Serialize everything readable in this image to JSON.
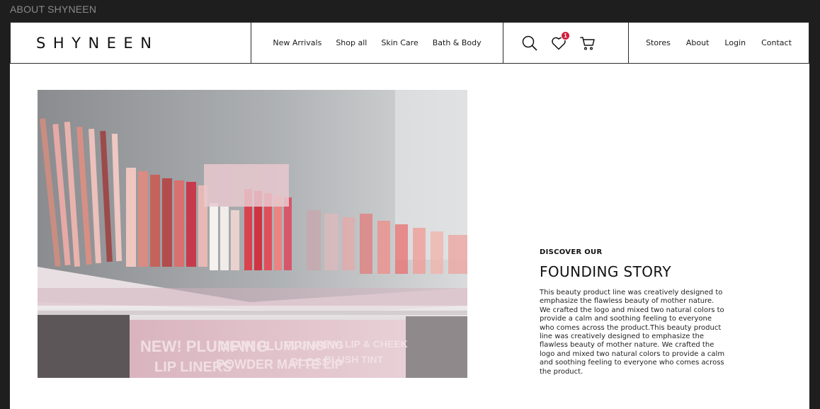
{
  "frame_label": "ABOUT SHYNEEN",
  "brand": {
    "logo_text": "SHYNEEN"
  },
  "nav": {
    "items": [
      {
        "label": "New Arrivals"
      },
      {
        "label": "Shop all"
      },
      {
        "label": "Skin Care"
      },
      {
        "label": "Bath & Body"
      }
    ]
  },
  "icons": {
    "search": "search-icon",
    "wishlist": "heart-icon",
    "wishlist_count": "1",
    "cart": "cart-icon",
    "badge_color": "#d21d3a"
  },
  "utility_nav": {
    "items": [
      {
        "label": "Stores"
      },
      {
        "label": "About"
      },
      {
        "label": "Login"
      },
      {
        "label": "Contact"
      }
    ]
  },
  "hero": {
    "image_subject": "store display shelf of lip pencils, lip tints and lip glosses",
    "shelf_signs": [
      "NEW! PLUMPING",
      "LIP LINERS",
      "NEW! PLUMPING",
      "POWDER MATTE LIP",
      "PLUMPING",
      "GLOSS",
      "NEW! LIP & CHEEK",
      "BLUSH TINT"
    ]
  },
  "story": {
    "eyebrow": "DISCOVER OUR",
    "title": "FOUNDING STORY",
    "body": "This beauty product line was creatively designed to emphasize the flawless beauty of mother nature. We crafted the logo and mixed two natural colors to provide a calm and soothing feeling to everyone who comes across the product.This beauty product line was creatively designed to emphasize the flawless beauty of mother nature. We crafted the logo and mixed two natural colors to provide a calm and soothing feeling to everyone who comes across the product."
  },
  "colors": {
    "frame_bg": "#1e1e1e",
    "page_bg": "#ffffff",
    "text": "#111111"
  }
}
